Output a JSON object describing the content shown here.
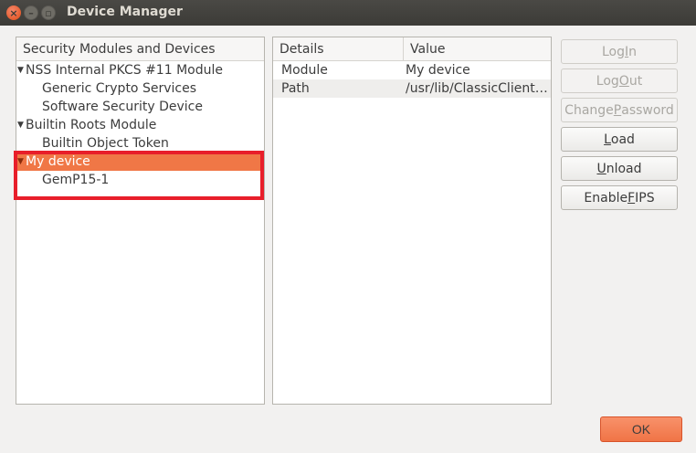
{
  "window": {
    "title": "Device Manager",
    "close_glyph": "×",
    "min_glyph": "–",
    "max_glyph": "▫"
  },
  "tree": {
    "header": "Security Modules and Devices",
    "arrow_glyph": "▼",
    "items": [
      {
        "label": "NSS Internal PKCS #11 Module",
        "level": 0
      },
      {
        "label": "Generic Crypto Services",
        "level": 1
      },
      {
        "label": "Software Security Device",
        "level": 1
      },
      {
        "label": "Builtin Roots Module",
        "level": 0
      },
      {
        "label": "Builtin Object Token",
        "level": 1
      },
      {
        "label": "My device",
        "level": 0,
        "selected": true
      },
      {
        "label": "GemP15-1",
        "level": 1
      }
    ]
  },
  "details": {
    "headers": [
      "Details",
      "Value"
    ],
    "rows": [
      {
        "key": "Module",
        "value": "My device"
      },
      {
        "key": "Path",
        "value": "/usr/lib/ClassicClient…"
      }
    ]
  },
  "buttons": {
    "log_in": {
      "pre": "Log ",
      "acc": "I",
      "post": "n",
      "enabled": false
    },
    "log_out": {
      "pre": "Log ",
      "acc": "O",
      "post": "ut",
      "enabled": false
    },
    "change_password": {
      "pre": "Change ",
      "acc": "P",
      "post": "assword",
      "enabled": false
    },
    "load": {
      "pre": "",
      "acc": "L",
      "post": "oad",
      "enabled": true
    },
    "unload": {
      "pre": "",
      "acc": "U",
      "post": "nload",
      "enabled": true
    },
    "enable_fips": {
      "pre": "Enable ",
      "acc": "F",
      "post": "IPS",
      "enabled": true
    },
    "ok": "OK"
  },
  "colors": {
    "selection": "#f07746",
    "highlight_box": "#e81e2a",
    "ok_button": "#f07446"
  }
}
